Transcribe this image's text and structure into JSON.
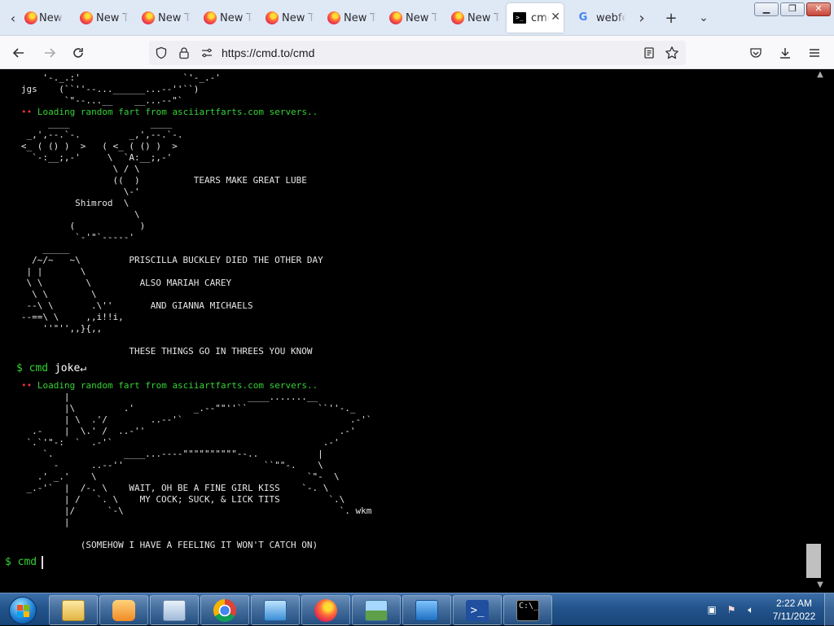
{
  "tabs": [
    {
      "label": "New Tab"
    },
    {
      "label": "New Tab"
    },
    {
      "label": "New Tab"
    },
    {
      "label": "New Tab"
    },
    {
      "label": "New Tab"
    },
    {
      "label": "New Tab"
    },
    {
      "label": "New Tab"
    },
    {
      "label": "New Tab"
    }
  ],
  "active_tab": {
    "label": "cmd",
    "icon_text": ">_"
  },
  "google_tab": {
    "label": "webfetch",
    "icon_text": "G"
  },
  "nav": {
    "url": "https://cmd.to/cmd"
  },
  "terminal": {
    "lines": [
      "       '-._.:'                   `'-_.-'",
      "   jgs    (``''--...______...--''``)",
      "           `\"--...__    __...--\"`",
      "LOADING",
      "        ____               ____",
      "    _,',--.`-.         _,',--.`-.",
      "   <_ ( () )  >   ( <_ ( () )  >",
      "     `-:__;,-'     \\  `A:__;,-'",
      "                    \\ / \\",
      "                    ((  )          TEARS MAKE GREAT LUBE",
      "                      \\-'",
      "             Shimrod  \\",
      "                        \\",
      "            (            )",
      "             `-'\"`-----'",
      "       _____",
      "     /~/~   ~\\         PRISCILLA BUCKLEY DIED THE OTHER DAY",
      "    | |       \\",
      "    \\ \\        \\         ALSO MARIAH CAREY",
      "     \\ \\        \\",
      "    --\\ \\       .\\''       AND GIANNA MICHAELS",
      "   --==\\ \\     ,,i!!i,",
      "       ''\"'',,}{,,",
      "",
      "                       THESE THINGS GO IN THREES YOU KNOW",
      "CMD_JOKE",
      "LOADING",
      "           |                                 ____.......__",
      "           |\\         .'           _.--\"\"''``             ``''-._",
      "           | \\  .'/        ..--'`                               .-'`",
      "     .-    |  \\.' /  ..-''                                    .-'",
      "    `.`'\"-:  `  .-'`                                       .-'",
      "       `.             ____...----\"\"\"\"\"\"\"\"\"\"--..           |",
      "         -      ..--''                          ``\"\"-.    \\",
      "      .' _.'    \\                                       `\"-  \\",
      "    _.-'`  |  /-. \\    WAIT, OH BE A FINE GIRL KISS    `-. \\",
      "           | /   `. \\    MY COCK; SUCK, & LICK TITS         `.\\",
      "           |/      `-\\                                        `. wkm",
      "           |",
      "",
      "              (SOMEHOW I HAVE A FEELING IT WON'T CATCH ON)"
    ],
    "loading_text": "Loading random fart from asciiartfarts.com servers..",
    "prompt": "$",
    "cmd_word": "cmd",
    "joke_word": "joke",
    "enter_glyph": "↵",
    "input_value": ""
  },
  "taskbar": {
    "clock_time": "2:22 AM",
    "clock_date": "7/11/2022"
  }
}
